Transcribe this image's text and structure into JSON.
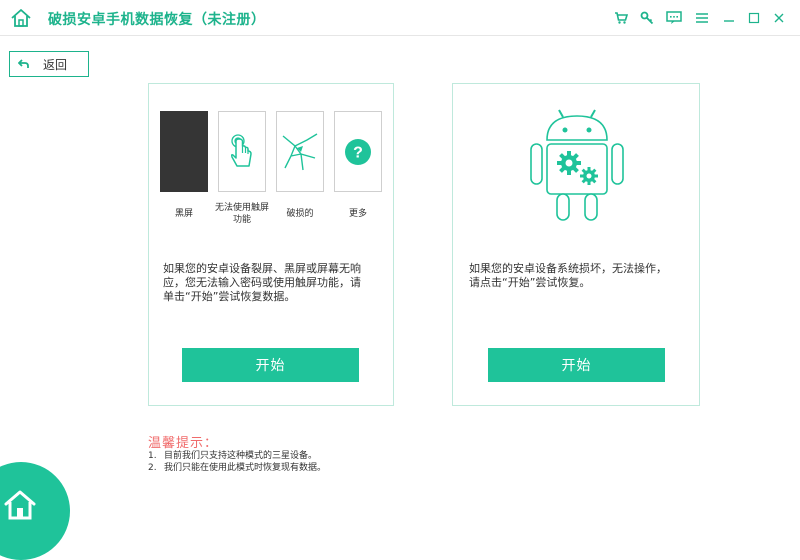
{
  "app": {
    "title": "破损安卓手机数据恢复（未注册）"
  },
  "toolbar": {
    "icons": [
      "cart-icon",
      "key-icon",
      "feedback-icon",
      "menu-icon",
      "minimize-icon",
      "maximize-icon",
      "close-icon"
    ]
  },
  "back": {
    "label": "返回"
  },
  "left_card": {
    "options": [
      {
        "label": "黑屏",
        "icon": "black-screen-icon"
      },
      {
        "label": "无法使用触屏功能",
        "icon": "touch-icon"
      },
      {
        "label": "破损的",
        "icon": "broken-screen-icon"
      },
      {
        "label": "更多",
        "icon": "question-icon"
      }
    ],
    "desc_lines": [
      "如果您的安卓设备裂屏、黑屏或屏幕无响",
      "应，您无法输入密码或使用触屏功能，请",
      "单击“开始”尝试恢复数据。"
    ],
    "start_label": "开始"
  },
  "right_card": {
    "icon": "android-gear-icon",
    "desc_lines": [
      "如果您的安卓设备系统损坏，无法操作，",
      "请点击“开始”尝试恢复。"
    ],
    "start_label": "开始"
  },
  "tips": {
    "title": "温馨提示：",
    "items": [
      {
        "num": "1.",
        "text": "目前我们只支持这种模式的三星设备。"
      },
      {
        "num": "2.",
        "text": "我们只能在使用此模式时恢复现有数据。"
      }
    ]
  },
  "colors": {
    "accent": "#1fc39a",
    "title": "#1db38c",
    "tip": "#f06b6b",
    "border": "#bfe9dc"
  }
}
